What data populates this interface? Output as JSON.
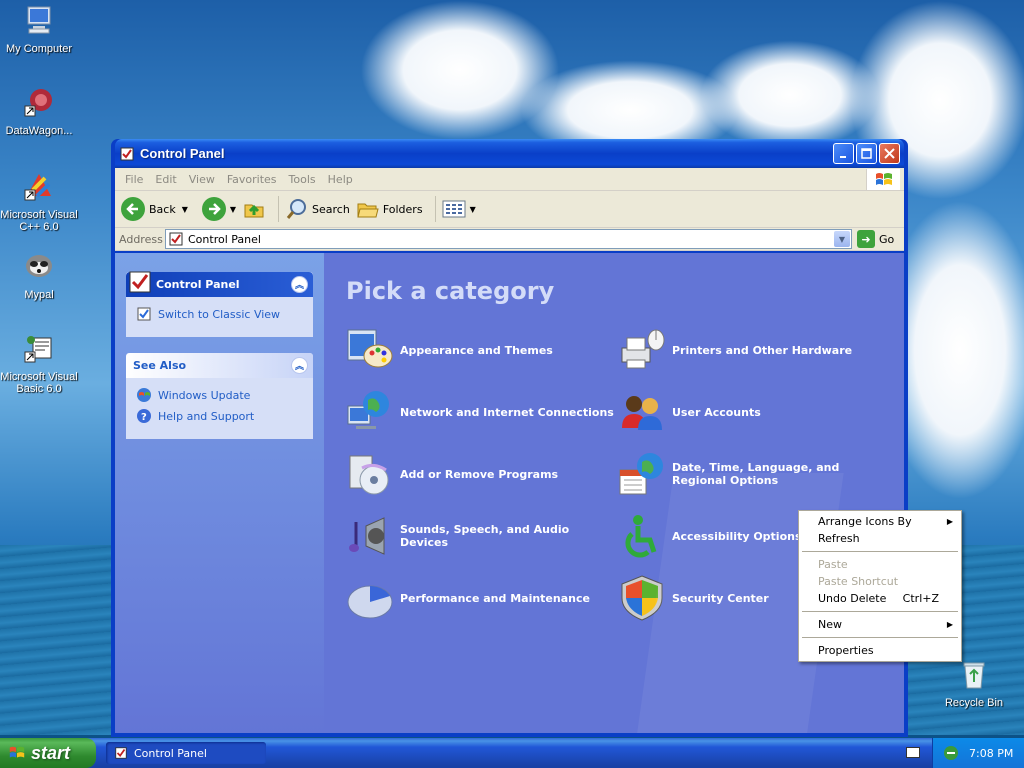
{
  "desktop": {
    "icons": [
      {
        "label": "My Computer"
      },
      {
        "label": "DataWagon..."
      },
      {
        "label": "Microsoft Visual C++ 6.0"
      },
      {
        "label": "Mypal"
      },
      {
        "label": "Microsoft Visual Basic 6.0"
      },
      {
        "label": "Recycle Bin"
      }
    ]
  },
  "window": {
    "title": "Control Panel",
    "menu": [
      "File",
      "Edit",
      "View",
      "Favorites",
      "Tools",
      "Help"
    ],
    "toolbar": {
      "back": "Back",
      "search": "Search",
      "folders": "Folders"
    },
    "address": {
      "label": "Address",
      "value": "Control Panel",
      "go": "Go"
    },
    "left_panel": {
      "control_panel": {
        "title": "Control Panel",
        "link": "Switch to Classic View"
      },
      "see_also": {
        "title": "See Also",
        "links": [
          "Windows Update",
          "Help and Support"
        ]
      }
    },
    "main": {
      "heading": "Pick a category",
      "categories": [
        {
          "label": "Appearance and Themes",
          "icon": "appearance-icon"
        },
        {
          "label": "Printers and Other Hardware",
          "icon": "printer-icon"
        },
        {
          "label": "Network and Internet Connections",
          "icon": "network-icon"
        },
        {
          "label": "User Accounts",
          "icon": "user-accounts-icon"
        },
        {
          "label": "Add or Remove Programs",
          "icon": "add-remove-icon"
        },
        {
          "label": "Date, Time, Language, and Regional Options",
          "icon": "date-time-icon"
        },
        {
          "label": "Sounds, Speech, and Audio Devices",
          "icon": "sound-icon"
        },
        {
          "label": "Accessibility Options",
          "icon": "accessibility-icon"
        },
        {
          "label": "Performance and Maintenance",
          "icon": "performance-icon"
        },
        {
          "label": "Security Center",
          "icon": "security-shield-icon"
        }
      ]
    }
  },
  "context_menu": {
    "items": [
      {
        "label": "Arrange Icons By",
        "submenu": true
      },
      {
        "label": "Refresh"
      },
      {
        "label": "Paste",
        "disabled": true
      },
      {
        "label": "Paste Shortcut",
        "disabled": true
      },
      {
        "label": "Undo Delete",
        "shortcut": "Ctrl+Z"
      },
      {
        "label": "New",
        "submenu": true
      },
      {
        "label": "Properties"
      }
    ]
  },
  "taskbar": {
    "start": "start",
    "task": "Control Panel",
    "clock": "7:08 PM"
  }
}
